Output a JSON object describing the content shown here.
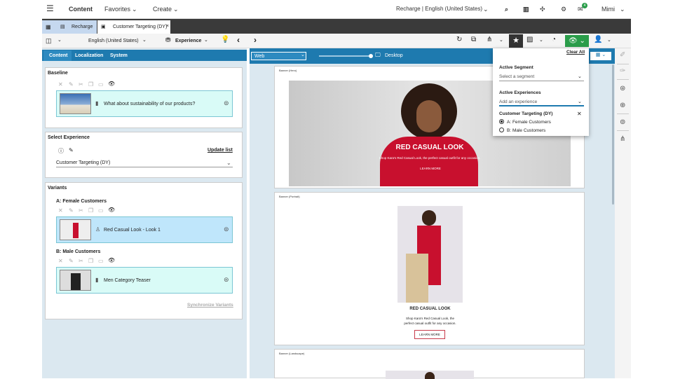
{
  "header": {
    "app_title": "Content",
    "favorites": "Favorites",
    "create": "Create",
    "site": "Recharge | English (United States)",
    "notifications_count": "4",
    "user": "Mimi"
  },
  "tabs": [
    {
      "label": "Recharge"
    },
    {
      "label": "Customer Targeting (DY)"
    }
  ],
  "toolbar": {
    "locale": "English (United States)",
    "mode": "Experience"
  },
  "left": {
    "tabs": [
      "Content",
      "Localization",
      "System"
    ],
    "baseline": {
      "title": "Baseline",
      "item": "What about sustainability of our products?"
    },
    "select_experience": {
      "title": "Select Experience",
      "update_list": "Update list",
      "value": "Customer Targeting (DY)"
    },
    "variants": {
      "title": "Variants",
      "a_title": "A: Female Customers",
      "a_item": "Red Casual Look - Look 1",
      "b_title": "B: Male Customers",
      "b_item": "Men Category Teaser",
      "sync": "Synchronize Variants"
    }
  },
  "preview": {
    "channel": "Web",
    "device": "Desktop",
    "clear_all": "Clear All",
    "banner_hero": {
      "label": "Banner (Hero)",
      "headline": "RED CASUAL LOOK",
      "subline": "Shop Kara's Red Casual Look, the perfect casual outfit for any occasion.",
      "button": "LEARN MORE"
    },
    "banner_portrait": {
      "label": "Banner (Portrait)",
      "headline": "RED CASUAL LOOK",
      "line1": "Shop Kara's Red Casual Look, the",
      "line2": "perfect casual outfit for any occasion.",
      "button": "LEARN MORE"
    },
    "banner_landscape": {
      "label": "Banner (Landscape)"
    }
  },
  "dropdown": {
    "active_segment": "Active Segment",
    "segment_placeholder": "Select a segment",
    "active_experiences": "Active Experiences",
    "experience_placeholder": "Add an experience",
    "experience_name": "Customer Targeting (DY)",
    "option_a": "A: Female Customers",
    "option_b": "B: Male Customers"
  },
  "colors": {
    "accent_blue": "#1e7aaf",
    "green": "#2a9d4a",
    "variant_bg": "#d9fbf7",
    "brand_red": "#c8102e"
  }
}
